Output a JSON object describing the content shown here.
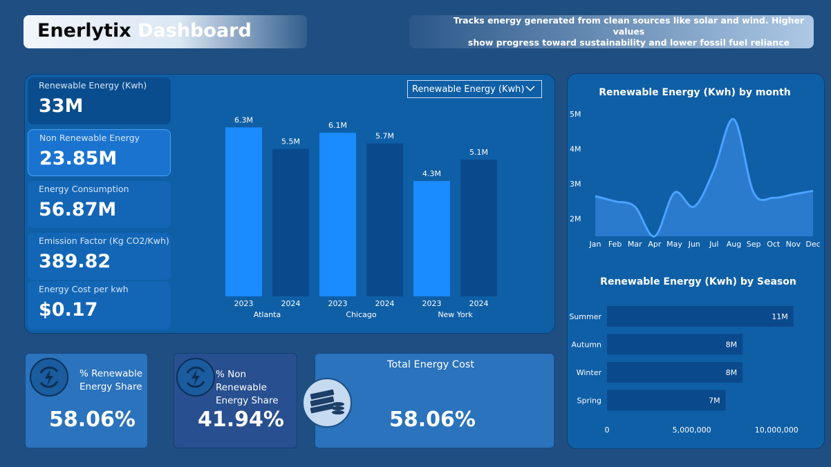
{
  "header": {
    "title_part1": "Enerlytix",
    "title_part2": "Dashboard",
    "description_line1": "Tracks energy generated from clean sources like solar and wind. Higher values",
    "description_line2": "show progress toward sustainability and lower fossil fuel reliance"
  },
  "kpis": [
    {
      "label": "Renewable Energy (Kwh)",
      "value": "33M"
    },
    {
      "label": "Non Renewable Energy",
      "value": "23.85M"
    },
    {
      "label": "Energy Consumption",
      "value": "56.87M"
    },
    {
      "label": "Emission Factor (Kg CO2/Kwh)",
      "value": "389.82"
    },
    {
      "label": "Energy Cost per kwh",
      "value": "$0.17"
    }
  ],
  "measure_selector": {
    "selected": "Renewable Energy (Kwh)"
  },
  "cards": {
    "renewable_share": {
      "label_line1": "% Renewable",
      "label_line2": "Energy Share",
      "value": "58.06%",
      "icon": "renewable-energy-icon"
    },
    "non_renewable_share": {
      "label_line1": "% Non Renewable",
      "label_line2": "Energy Share",
      "value": "41.94%",
      "icon": "non-renewable-energy-icon"
    },
    "total_cost": {
      "label": "Total Energy Cost",
      "value": "58.06%",
      "icon": "money-stack-icon"
    }
  },
  "colors": {
    "background": "#1f4e82",
    "panel": "#0f5fa6",
    "bar_2023": "#1a8cff",
    "bar_2024": "#0a4a8c",
    "line": "#4aa3ff",
    "season_bar": "#0a4a8c"
  },
  "chart_data": [
    {
      "type": "bar",
      "title": "",
      "groups": [
        "Atlanta",
        "Chicago",
        "New York"
      ],
      "categories": [
        "2023",
        "2024"
      ],
      "series": [
        {
          "group": "Atlanta",
          "values": [
            6.3,
            5.5
          ],
          "labels": [
            "6.3M",
            "5.5M"
          ]
        },
        {
          "group": "Chicago",
          "values": [
            6.1,
            5.7
          ],
          "labels": [
            "6.1M",
            "5.7M"
          ]
        },
        {
          "group": "New York",
          "values": [
            4.3,
            5.1
          ],
          "labels": [
            "4.3M",
            "5.1M"
          ]
        }
      ],
      "unit": "M",
      "ylim": [
        0,
        6.8
      ]
    },
    {
      "type": "area",
      "title": "Renewable Energy (Kwh) by month",
      "x": [
        "Jan",
        "Feb",
        "Mar",
        "Apr",
        "May",
        "Jun",
        "Jul",
        "Aug",
        "Sep",
        "Oct",
        "Nov",
        "Dec"
      ],
      "values": [
        2.65,
        2.5,
        2.35,
        1.5,
        2.75,
        2.35,
        3.4,
        4.85,
        2.75,
        2.6,
        2.7,
        2.8
      ],
      "yticks": [
        "2M",
        "3M",
        "4M",
        "5M"
      ],
      "ytick_values": [
        2,
        3,
        4,
        5
      ],
      "ylim": [
        1.5,
        5.2
      ]
    },
    {
      "type": "bar",
      "orientation": "horizontal",
      "title": "Renewable Energy (Kwh) by Season",
      "categories": [
        "Summer",
        "Autumn",
        "Winter",
        "Spring"
      ],
      "values": [
        11000000,
        8000000,
        8000000,
        7000000
      ],
      "labels": [
        "11M",
        "8M",
        "8M",
        "7M"
      ],
      "xticks": [
        "0",
        "5,000,000",
        "10,000,000"
      ],
      "xtick_values": [
        0,
        5000000,
        10000000
      ],
      "xlim": [
        0,
        11500000
      ]
    }
  ]
}
